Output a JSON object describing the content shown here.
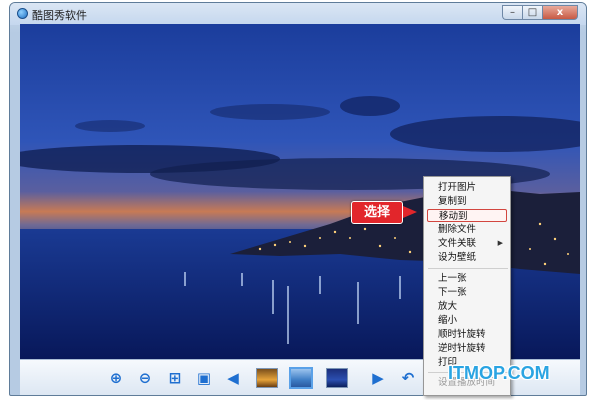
{
  "window": {
    "title": "酷图秀软件",
    "icon": "app-icon",
    "controls": {
      "minimize": "–",
      "maximize": "□",
      "close": "x"
    }
  },
  "toolbar": {
    "buttons": [
      {
        "name": "zoom-in-icon",
        "glyph": "⊕"
      },
      {
        "name": "zoom-out-icon",
        "glyph": "⊖"
      },
      {
        "name": "fit-icon",
        "glyph": "⊞"
      },
      {
        "name": "slideshow-icon",
        "glyph": "▣"
      },
      {
        "name": "previous-icon",
        "glyph": "◀"
      },
      {
        "name": "next-icon",
        "glyph": "▶"
      },
      {
        "name": "rotate-icon",
        "glyph": "↶"
      }
    ]
  },
  "context_menu": {
    "items": [
      {
        "label": "打开图片",
        "state": "normal"
      },
      {
        "label": "复制到",
        "state": "normal"
      },
      {
        "label": "移动到",
        "state": "highlighted"
      },
      {
        "label": "删除文件",
        "state": "normal"
      },
      {
        "label": "文件关联",
        "state": "submenu"
      },
      {
        "label": "设为壁纸",
        "state": "normal"
      },
      {
        "label": "上一张",
        "state": "normal"
      },
      {
        "label": "下一张",
        "state": "normal"
      },
      {
        "label": "放大",
        "state": "normal"
      },
      {
        "label": "缩小",
        "state": "normal"
      },
      {
        "label": "顺时针旋转",
        "state": "normal"
      },
      {
        "label": "逆时针旋转",
        "state": "normal"
      },
      {
        "label": "打印",
        "state": "normal"
      },
      {
        "label": "设置播放时间",
        "state": "disabled"
      }
    ],
    "submenu_arrow": "▶"
  },
  "callout": {
    "label": "选择",
    "color": "#e2262b"
  },
  "watermark": {
    "text": "ITMOP.COM",
    "color": "#2aa4e2"
  },
  "colors": {
    "accent": "#1f6fd0",
    "window_frame": "#b6cbe3"
  }
}
